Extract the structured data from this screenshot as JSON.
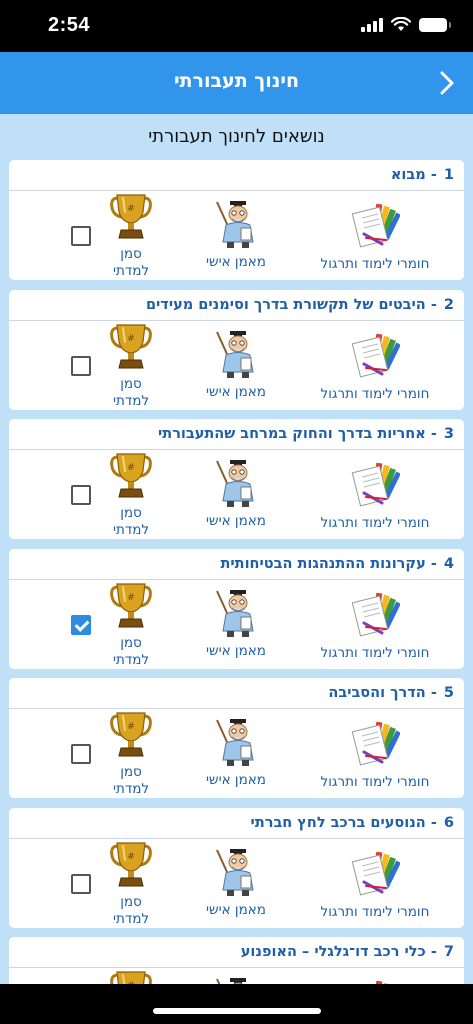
{
  "status_bar": {
    "time": "2:54"
  },
  "nav": {
    "title": "חינוך תעבורתי"
  },
  "section_title": "נושאים לחינוך תעבורתי",
  "labels": {
    "materials": "חומרי לימוד ותרגול",
    "trainer": "מאמן אישי",
    "mark_line1": "סמן",
    "mark_line2": "למדתי"
  },
  "cards": [
    {
      "number": "1",
      "title": "מבוא",
      "checked": false
    },
    {
      "number": "2",
      "title": "היבטים של תקשורת בדרך וסימנים מעידים",
      "checked": false
    },
    {
      "number": "3",
      "title": "אחריות בדרך והחוק במרחב שהתעבורתי",
      "checked": false
    },
    {
      "number": "4",
      "title": "עקרונות ההתנהגות הבטיחותית",
      "checked": true
    },
    {
      "number": "5",
      "title": "הדרך והסביבה",
      "checked": false
    },
    {
      "number": "6",
      "title": "הנוסעים ברכב לחץ חברתי",
      "checked": false
    },
    {
      "number": "7",
      "title": "כלי רכב דו־גלגלי – האופנוע",
      "checked": false
    }
  ],
  "colors": {
    "nav_blue": "#3195ec",
    "content_bg": "#bfe0f7",
    "title_blue": "#1f5fa8",
    "checkbox_checked": "#2f8be0"
  },
  "icons": [
    "chevron-right-icon",
    "books-icon",
    "teacher-icon",
    "trophy-icon",
    "wifi-icon",
    "battery-icon",
    "signal-icon"
  ]
}
